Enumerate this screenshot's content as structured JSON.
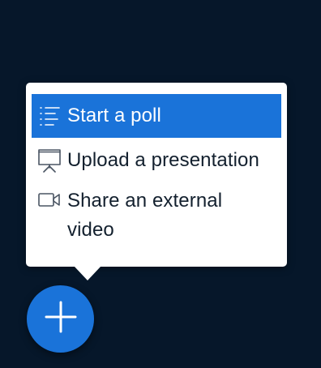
{
  "actions_menu": {
    "items": [
      {
        "label": "Start a poll",
        "icon": "poll-list-icon",
        "state": "highlighted"
      },
      {
        "label": "Upload a presentation",
        "icon": "presentation-board-icon"
      },
      {
        "label": "Share an external video",
        "icon": "video-camera-icon"
      }
    ]
  },
  "fab": {
    "icon": "plus-icon"
  },
  "colors": {
    "background": "#06172a",
    "accent": "#1a73d9",
    "menu_background": "#ffffff",
    "text": "#13202e"
  }
}
